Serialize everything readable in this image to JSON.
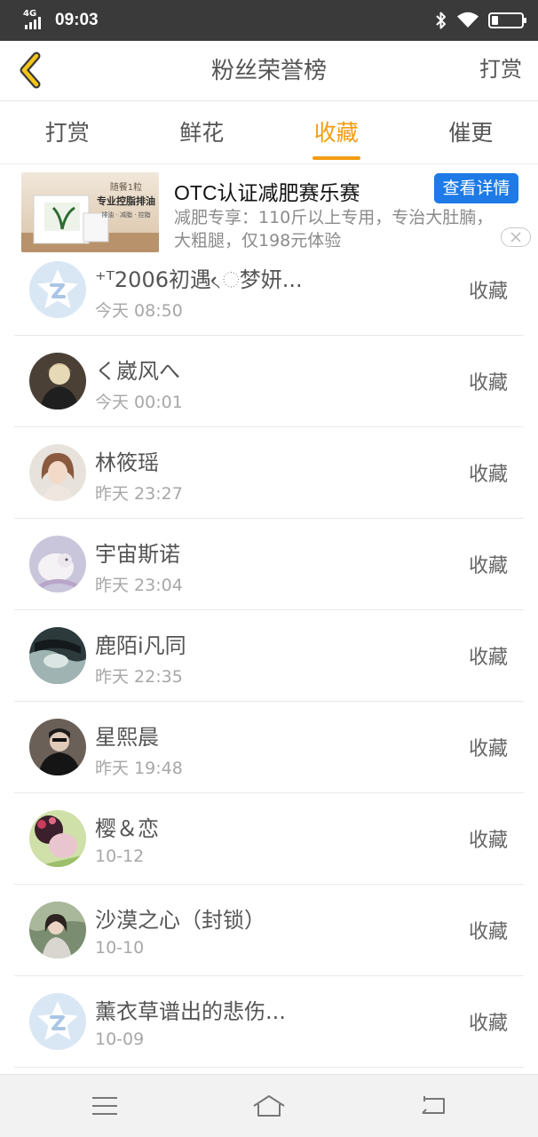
{
  "status_bar": {
    "network": "4G",
    "time": "09:03"
  },
  "header": {
    "back_icon": "chevron-left-icon",
    "title": "粉丝荣誉榜",
    "action": "打赏"
  },
  "tabs": [
    {
      "label": "打赏",
      "active": false
    },
    {
      "label": "鲜花",
      "active": false
    },
    {
      "label": "收藏",
      "active": true
    },
    {
      "label": "催更",
      "active": false
    }
  ],
  "ad": {
    "title": "OTC认证减肥赛乐赛",
    "button": "查看详情",
    "description": "减肥专享：110斤以上专用，专治大肚腩，大粗腿，仅198元体验",
    "image_text": {
      "line1": "随餐1粒",
      "line2": "专业控脂排油",
      "line3": "排油 · 减脂 · 控脂"
    }
  },
  "list": {
    "rows": [
      {
        "name": "⁺ᵀ2006初遇ᨙ梦妍...",
        "time": "今天 08:50",
        "action": "收藏"
      },
      {
        "name": "く崴风へ",
        "time": "今天 00:01",
        "action": "收藏"
      },
      {
        "name": "林筱瑶",
        "time": "昨天 23:27",
        "action": "收藏"
      },
      {
        "name": "宇宙斯诺",
        "time": "昨天 23:04",
        "action": "收藏"
      },
      {
        "name": "鹿陌i凡同",
        "time": "昨天 22:35",
        "action": "收藏"
      },
      {
        "name": "星熙晨",
        "time": "昨天 19:48",
        "action": "收藏"
      },
      {
        "name": "樱＆恋",
        "time": "10-12",
        "action": "收藏"
      },
      {
        "name": "沙漠之心（封锁）",
        "time": "10-10",
        "action": "收藏"
      },
      {
        "name": "薰衣草谱出的悲伤...",
        "time": "10-09",
        "action": "收藏"
      }
    ]
  },
  "colors": {
    "accent": "#f39c12",
    "ad_button": "#1d7ae6",
    "status_bar": "#3a3a3a"
  },
  "system_nav": {
    "menu_icon": "menu-icon",
    "home_icon": "home-icon",
    "back_icon": "back-icon"
  }
}
